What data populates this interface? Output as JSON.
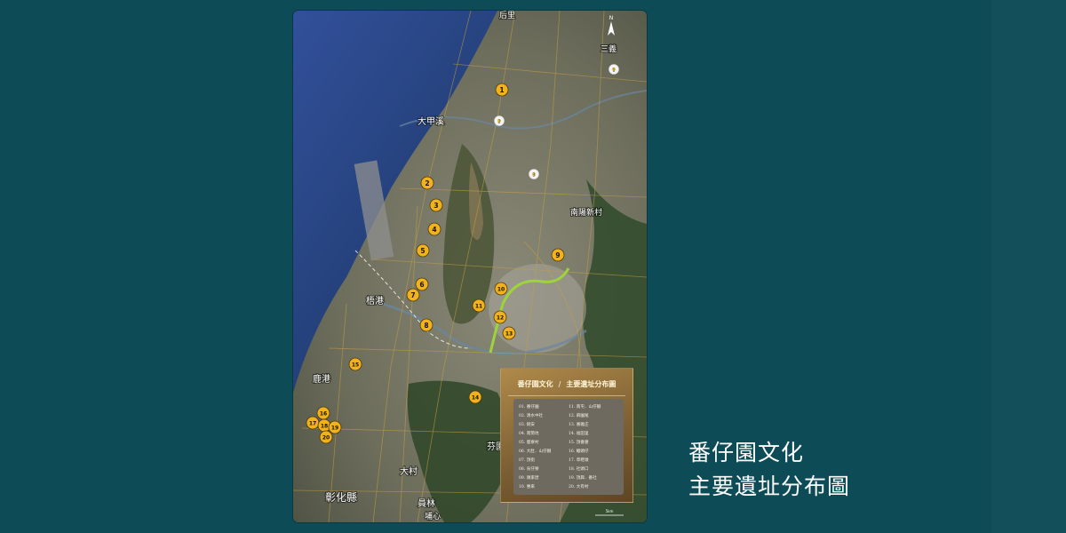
{
  "caption": {
    "line1": "番仔園文化",
    "line2": "主要遺址分布圖"
  },
  "map": {
    "place_labels": [
      {
        "id": "dajia",
        "text": "大甲溪"
      },
      {
        "id": "wuqi",
        "text": "梧港"
      },
      {
        "id": "nanyang",
        "text": "南陽新村"
      },
      {
        "id": "lugang",
        "text": "鹿港"
      },
      {
        "id": "changhua",
        "text": "彰化縣"
      },
      {
        "id": "dacun",
        "text": "大村"
      },
      {
        "id": "yuanlin",
        "text": "員林"
      },
      {
        "id": "fenyuan",
        "text": "芬園"
      },
      {
        "id": "puxin",
        "text": "埔心"
      },
      {
        "id": "sanyi",
        "text": "三義"
      },
      {
        "id": "houli",
        "text": "后里"
      }
    ],
    "north_label": "N",
    "scale_label": "5km",
    "markers": [
      "1",
      "2",
      "3",
      "4",
      "5",
      "6",
      "7",
      "8",
      "9",
      "10",
      "11",
      "12",
      "13",
      "14",
      "15",
      "16",
      "17",
      "18",
      "19",
      "20"
    ],
    "flower_markers": [
      "1",
      "2",
      "3"
    ],
    "colors": {
      "marker_fill": "#f2b21c",
      "route": "#9ed43a",
      "legend_gold": "#9c7a40"
    }
  },
  "legend": {
    "title_left": "番仔園文化",
    "title_right": "主要遺址分布圖",
    "items": [
      "01. 番仔園",
      "02. 清水中社",
      "03. 銅安",
      "04. 南勢坑",
      "05. 鹿寮村",
      "06. 大肚．山仔腳",
      "07. 頂街",
      "08. 烏仔寮",
      "09. 頭家厝",
      "10. 惠來",
      "11. 南屯．山仔腳",
      "12. 麻園尾",
      "13. 番雅庄",
      "14. 福田里",
      "15. 頂番婆",
      "16. 轆頭仔",
      "17. 草鞋墩",
      "18. 社頭口",
      "19. 頂興．番社",
      "20. 大有村"
    ]
  }
}
